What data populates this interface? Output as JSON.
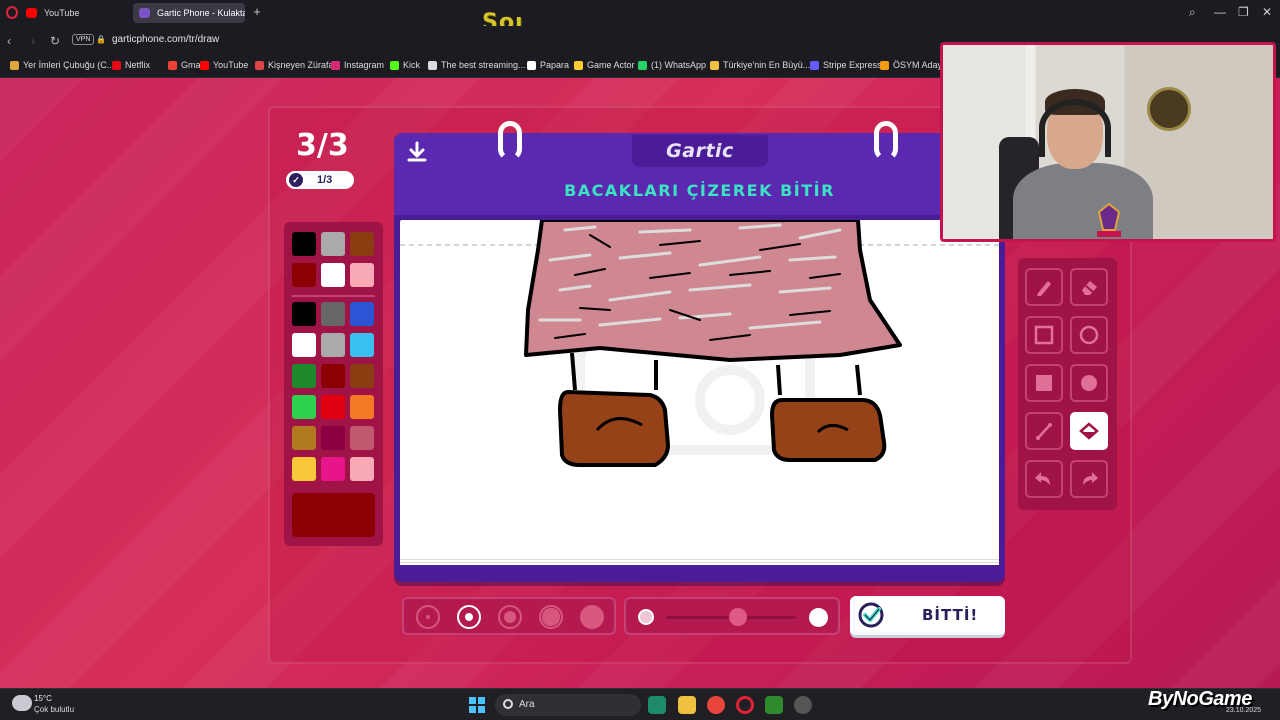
{
  "browser": {
    "tabs": [
      {
        "label": "YouTube",
        "active": false
      },
      {
        "label": "Gartic Phone - Kulaktan K",
        "active": true
      }
    ],
    "overlay_text": "Soı",
    "vpn_badge": "VPN",
    "url": "garticphone.com/tr/draw",
    "bookmarks": [
      {
        "label": "Yer İmleri Çubuğu (C...",
        "color": "#e0a53a"
      },
      {
        "label": "Netflix",
        "color": "#e50914"
      },
      {
        "label": "Gmail",
        "color": "#ea4335"
      },
      {
        "label": "YouTube",
        "color": "#ff0000"
      },
      {
        "label": "Kişneyen Zürafa",
        "color": "#d44"
      },
      {
        "label": "Instagram",
        "color": "#d62976"
      },
      {
        "label": "Kick",
        "color": "#53fc18"
      },
      {
        "label": "The best streaming...",
        "color": "#ddd"
      },
      {
        "label": "Papara",
        "color": "#fff"
      },
      {
        "label": "Game Actor",
        "color": "#ffcc33"
      },
      {
        "label": "(1) WhatsApp",
        "color": "#25d366"
      },
      {
        "label": "Türkiye'nin En Büyü...",
        "color": "#f0c040"
      },
      {
        "label": "Stripe Express",
        "color": "#635bff"
      },
      {
        "label": "ÖSYM Aday İ",
        "color": "#f39c12"
      }
    ]
  },
  "game": {
    "round": "3/3",
    "progress": "1/3",
    "logo": "Gartic",
    "prompt": "BACAKLARI ÇİZEREK BİTİR",
    "done_label": "BİTTİ!",
    "palette": {
      "top": [
        "#000000",
        "#aaaaaa",
        "#8b3d12",
        "#8b0000",
        "#ffffff",
        "#f8a9b5"
      ],
      "bottom": [
        "#000000",
        "#666666",
        "#2a56d6",
        "#ffffff",
        "#aaaaaa",
        "#39c0f0",
        "#1f8a2b",
        "#8b0000",
        "#8b3d12",
        "#2ed14e",
        "#e00010",
        "#f47a25",
        "#b07a20",
        "#8b0040",
        "#c05870",
        "#f8c73a",
        "#e8148a",
        "#f8a9b5"
      ],
      "selected": "#8b0000"
    },
    "tools": [
      "pencil-icon",
      "eraser-icon",
      "rectangle-icon",
      "ellipse-icon",
      "filled-rectangle-icon",
      "filled-ellipse-icon",
      "line-icon",
      "fill-bucket-icon",
      "undo-icon",
      "redo-icon"
    ],
    "active_tool": "fill-bucket-icon",
    "brush_sizes": 5,
    "active_brush": 2,
    "opacity_level": 0.55
  },
  "taskbar": {
    "temperature": "15°C",
    "weather": "Çok bulutlu",
    "search_placeholder": "Ara",
    "watermark": "ByNoGame",
    "date": "23.10.2025"
  }
}
